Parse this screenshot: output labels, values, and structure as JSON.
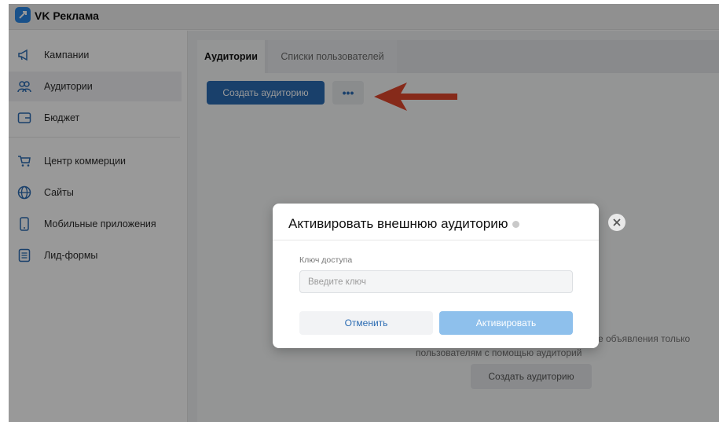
{
  "app": {
    "title": "VK Реклама",
    "accent": "#2a6bb3"
  },
  "sidebar": {
    "items": [
      {
        "label": "Кампании",
        "icon": "megaphone-icon"
      },
      {
        "label": "Аудитории",
        "icon": "users-icon",
        "active": true
      },
      {
        "label": "Бюджет",
        "icon": "wallet-icon"
      },
      {
        "label": "Центр коммерции",
        "icon": "cart-icon"
      },
      {
        "label": "Сайты",
        "icon": "globe-icon"
      },
      {
        "label": "Мобильные приложения",
        "icon": "phone-icon"
      },
      {
        "label": "Лид-формы",
        "icon": "form-icon"
      }
    ]
  },
  "main": {
    "tabs": [
      {
        "label": "Аудитории",
        "active": true
      },
      {
        "label": "Списки пользователей",
        "active": false
      }
    ],
    "create_button": "Создать аудиторию",
    "more_button": "•••",
    "empty_text_line1": "е объявления только",
    "empty_text_line2": "пользователям с помощью аудиторий",
    "empty_create_button": "Создать аудиторию"
  },
  "modal": {
    "title": "Активировать внешнюю аудиторию",
    "field_label": "Ключ доступа",
    "input_placeholder": "Введите ключ",
    "input_value": "",
    "cancel_button": "Отменить",
    "activate_button": "Активировать"
  }
}
